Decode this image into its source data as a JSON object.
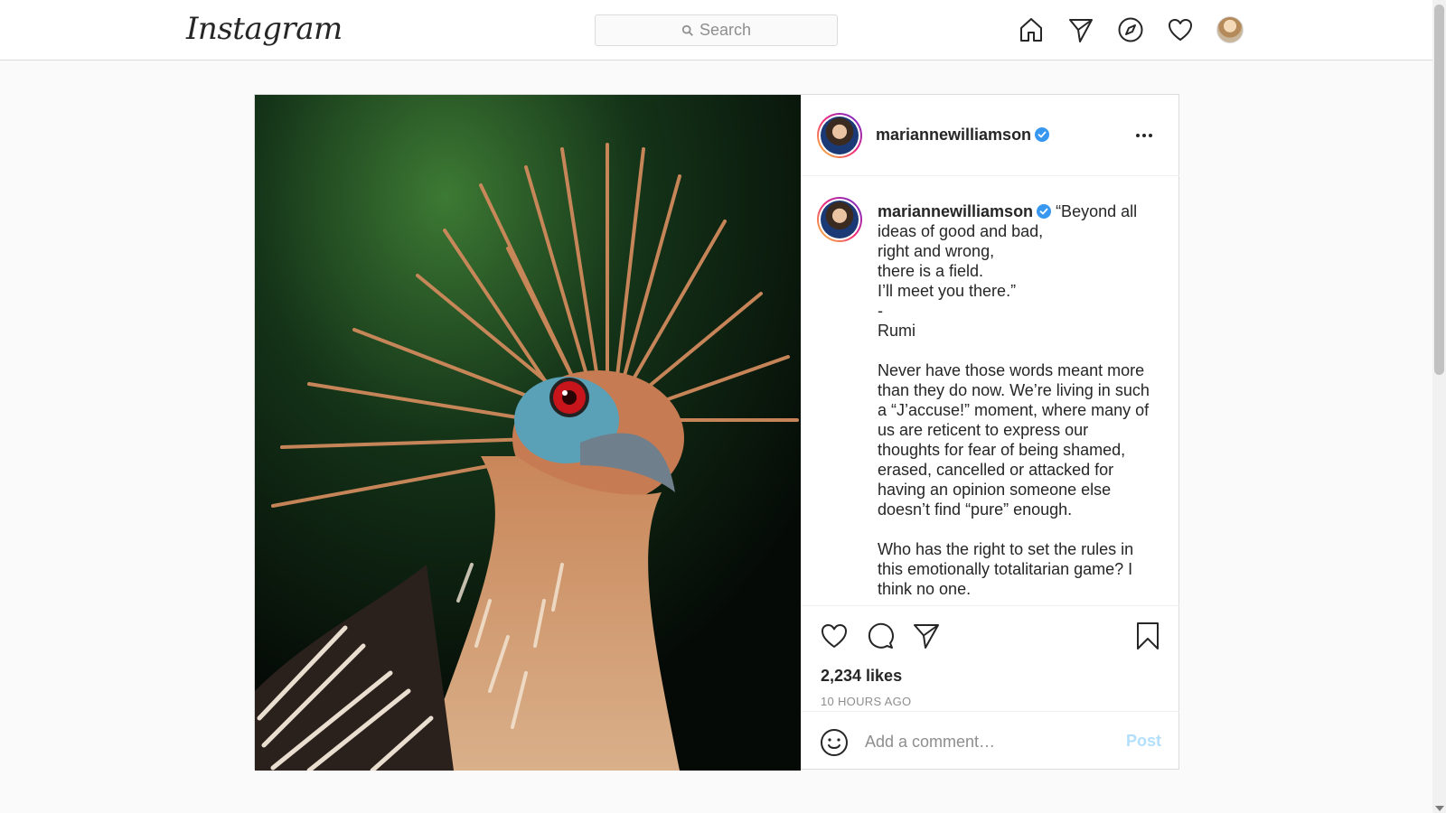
{
  "nav": {
    "logo": "Instagram",
    "search_placeholder": "Search",
    "icons": [
      "home-icon",
      "direct-icon",
      "explore-icon",
      "activity-heart-icon",
      "profile-avatar"
    ]
  },
  "post": {
    "username": "mariannewilliamson",
    "verified": true,
    "caption_username": "mariannewilliamson",
    "caption_text": " “Beyond all ideas of good and bad,\nright and wrong,\nthere is a field.\nI’ll meet you there.”\n-\nRumi\n\nNever have those words meant more than they do now. We’re living in such a “J’accuse!” moment, where many of us are reticent to express our thoughts for fear of being shamed, erased, cancelled or attacked for having an opinion someone else doesn’t find “pure” enough.\n\nWho has the right to set the rules in this emotionally totalitarian game? I think no one.",
    "likes": "2,234 likes",
    "timestamp": "10 HOURS AGO",
    "comment_placeholder": "Add a comment…",
    "post_button": "Post"
  },
  "colors": {
    "verified": "#3897f0",
    "post_button_disabled": "#b2dffc",
    "border": "#dbdbdb"
  }
}
